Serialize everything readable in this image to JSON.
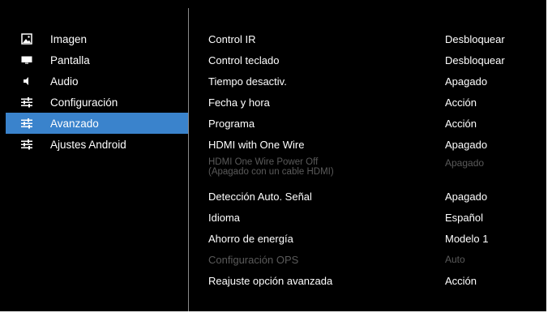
{
  "sidebar": {
    "items": [
      {
        "label": "Imagen",
        "icon": "image-icon",
        "active": false
      },
      {
        "label": "Pantalla",
        "icon": "monitor-icon",
        "active": false
      },
      {
        "label": "Audio",
        "icon": "speaker-icon",
        "active": false
      },
      {
        "label": "Configuración",
        "icon": "sliders-icon",
        "active": false
      },
      {
        "label": "Avanzado",
        "icon": "sliders-icon",
        "active": true
      },
      {
        "label": "Ajustes Android",
        "icon": "sliders-icon",
        "active": false
      }
    ]
  },
  "settings": {
    "rows": [
      {
        "label": "Control IR",
        "value": "Desbloquear",
        "enabled": true
      },
      {
        "label": "Control teclado",
        "value": "Desbloquear",
        "enabled": true
      },
      {
        "label": "Tiempo desactiv.",
        "value": "Apagado",
        "enabled": true
      },
      {
        "label": "Fecha y hora",
        "value": "Acción",
        "enabled": true
      },
      {
        "label": "Programa",
        "value": "Acción",
        "enabled": true
      },
      {
        "label": "HDMI with One Wire",
        "value": "Apagado",
        "enabled": true
      },
      {
        "label_line1": "HDMI One Wire Power Off",
        "label_line2": "(Apagado con un cable HDMI)",
        "value": "Apagado",
        "enabled": false
      },
      {
        "label": "Detección Auto. Señal",
        "value": "Apagado",
        "enabled": true
      },
      {
        "label": "Idioma",
        "value": "Español",
        "enabled": true
      },
      {
        "label": "Ahorro de energía",
        "value": "Modelo 1",
        "enabled": true
      },
      {
        "label": "Configuración OPS",
        "value": "Auto",
        "enabled": false
      },
      {
        "label": "Reajuste opción avanzada",
        "value": "Acción",
        "enabled": true
      }
    ]
  },
  "colors": {
    "background": "#000000",
    "selected": "#3a83cc",
    "text": "#ffffff",
    "disabled_text": "#5a5a5a",
    "divider": "#8a8a8a"
  }
}
